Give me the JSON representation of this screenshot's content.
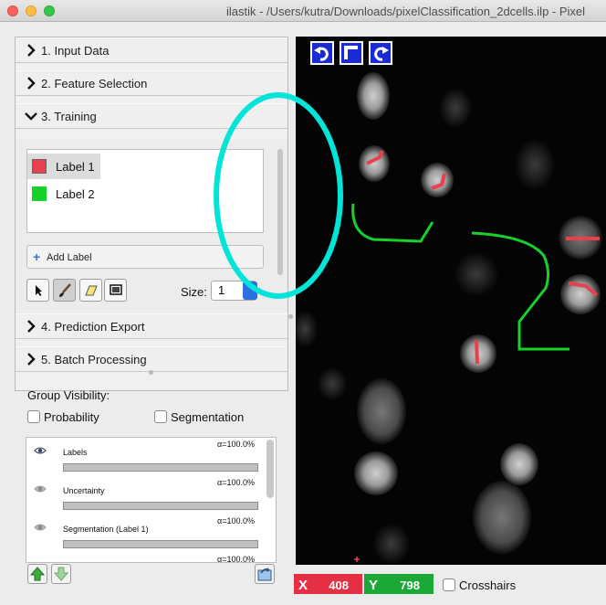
{
  "window": {
    "title": "ilastik - /Users/kutra/Downloads/pixelClassification_2dcells.ilp - Pixel"
  },
  "applets": [
    {
      "label": "1. Input Data",
      "expanded": false
    },
    {
      "label": "2. Feature Selection",
      "expanded": false
    },
    {
      "label": "3. Training",
      "expanded": true
    },
    {
      "label": "4. Prediction Export",
      "expanded": false
    },
    {
      "label": "5. Batch Processing",
      "expanded": false
    }
  ],
  "training": {
    "labels": [
      {
        "name": "Label 1",
        "color": "#e8414e",
        "selected": true
      },
      {
        "name": "Label 2",
        "color": "#16d12a",
        "selected": false
      }
    ],
    "add_label": "Add Label",
    "size_label": "Size:",
    "size_value": "1",
    "tools": [
      "pointer-icon",
      "brush-icon",
      "eraser-icon",
      "threshold-icon"
    ]
  },
  "group_visibility": {
    "title": "Group Visibility:",
    "probability": "Probability",
    "segmentation": "Segmentation"
  },
  "layers": [
    {
      "name": "Labels",
      "opacity": "α=100.0%",
      "visible": true
    },
    {
      "name": "Uncertainty",
      "opacity": "α=100.0%",
      "visible": false
    },
    {
      "name": "Segmentation (Label 1)",
      "opacity": "α=100.0%",
      "visible": false
    },
    {
      "name": "",
      "opacity": "α=100.0%",
      "visible": false
    }
  ],
  "status": {
    "x_key": "X",
    "x_value": "408",
    "y_key": "Y",
    "y_value": "798",
    "crosshairs": "Crosshairs"
  },
  "colors": {
    "label1": "#e8414e",
    "label2": "#16d12a",
    "annotation_ellipse": "#00e5d8"
  }
}
